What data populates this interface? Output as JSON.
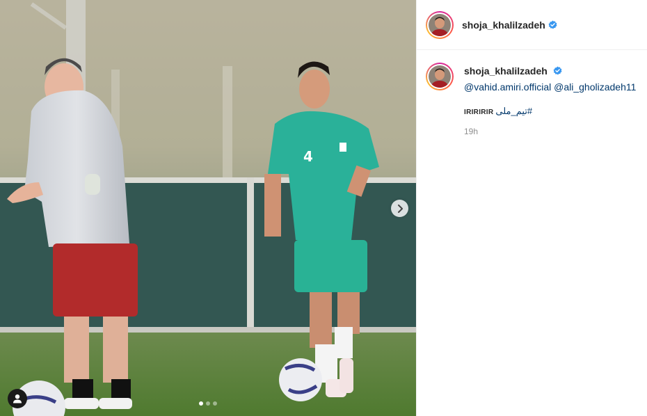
{
  "post": {
    "author": "shoja_khalilzadeh",
    "verified": true,
    "media_count": 3,
    "active_slide": 1
  },
  "header": {
    "username": "shoja_khalilzadeh"
  },
  "caption": {
    "username": "shoja_khalilzadeh",
    "mentions": [
      "@vahid.amiri.official",
      "@ali_gholizadeh11"
    ],
    "text": "IRIRIRIR",
    "hashtag": "#تیم_ملی",
    "time": "19h"
  },
  "colors": {
    "verified_badge": "#3897f0",
    "link": "#00376b",
    "muted_text": "#8e8e8e",
    "divider": "#efefef"
  },
  "icons": {
    "next": "chevron-right-icon",
    "tagged_users": "user-tag-icon",
    "verified": "verified-badge-icon"
  }
}
